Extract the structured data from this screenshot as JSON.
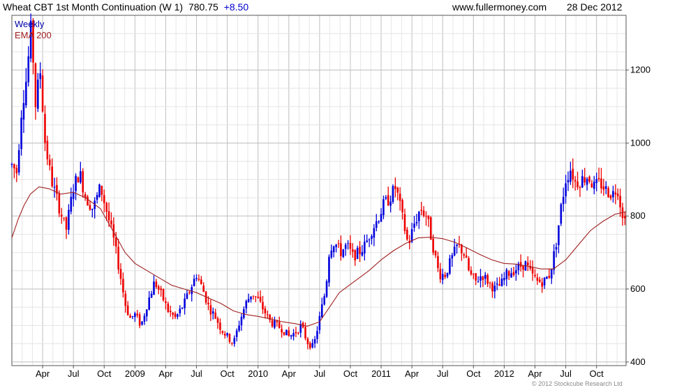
{
  "header": {
    "title": "Wheat CBT 1st Month Continuation (W 1)",
    "last_price": "780.75",
    "change": "+8.50",
    "website": "www.fullermoney.com",
    "date": "28 Dec 2012"
  },
  "credit": "© 2012 Stockcube Research Ltd",
  "colors": {
    "up": "#0000dd",
    "down": "#ee0000",
    "ema": "#a02020",
    "grid": "#c8c8c8",
    "legend_weekly": "#0000aa",
    "legend_ema": "#a02020"
  },
  "chart_data": {
    "type": "candlestick",
    "title": "Wheat CBT 1st Month Continuation (W 1)",
    "legend": [
      {
        "label": "Weekly",
        "color": "#0000aa"
      },
      {
        "label": "EMA 200",
        "color": "#a02020"
      }
    ],
    "ylim": [
      390,
      1350
    ],
    "y_ticks": [
      400,
      600,
      800,
      1000,
      1200
    ],
    "x_range": [
      2008.0,
      2012.99
    ],
    "x_ticks": [
      {
        "label": "Apr",
        "x": 2008.25
      },
      {
        "label": "Jul",
        "x": 2008.5
      },
      {
        "label": "Oct",
        "x": 2008.75
      },
      {
        "label": "2009",
        "x": 2009.0
      },
      {
        "label": "Apr",
        "x": 2009.25
      },
      {
        "label": "Jul",
        "x": 2009.5
      },
      {
        "label": "Oct",
        "x": 2009.75
      },
      {
        "label": "2010",
        "x": 2010.0
      },
      {
        "label": "Apr",
        "x": 2010.25
      },
      {
        "label": "Jul",
        "x": 2010.5
      },
      {
        "label": "Oct",
        "x": 2010.75
      },
      {
        "label": "2011",
        "x": 2011.0
      },
      {
        "label": "Apr",
        "x": 2011.25
      },
      {
        "label": "Jul",
        "x": 2011.5
      },
      {
        "label": "Oct",
        "x": 2011.75
      },
      {
        "label": "2012",
        "x": 2012.0
      },
      {
        "label": "Apr",
        "x": 2012.25
      },
      {
        "label": "Jul",
        "x": 2012.5
      },
      {
        "label": "Oct",
        "x": 2012.75
      }
    ],
    "price_path": [
      [
        2008.0,
        940
      ],
      [
        2008.04,
        920
      ],
      [
        2008.08,
        1100
      ],
      [
        2008.12,
        1180
      ],
      [
        2008.16,
        1330
      ],
      [
        2008.19,
        1100
      ],
      [
        2008.23,
        1200
      ],
      [
        2008.27,
        1000
      ],
      [
        2008.32,
        900
      ],
      [
        2008.38,
        830
      ],
      [
        2008.44,
        760
      ],
      [
        2008.5,
        880
      ],
      [
        2008.55,
        920
      ],
      [
        2008.6,
        850
      ],
      [
        2008.66,
        820
      ],
      [
        2008.72,
        880
      ],
      [
        2008.78,
        800
      ],
      [
        2008.83,
        730
      ],
      [
        2008.88,
        640
      ],
      [
        2008.92,
        560
      ],
      [
        2008.96,
        520
      ],
      [
        2009.0,
        530
      ],
      [
        2009.05,
        500
      ],
      [
        2009.1,
        560
      ],
      [
        2009.16,
        620
      ],
      [
        2009.22,
        580
      ],
      [
        2009.27,
        540
      ],
      [
        2009.33,
        520
      ],
      [
        2009.4,
        560
      ],
      [
        2009.45,
        600
      ],
      [
        2009.5,
        640
      ],
      [
        2009.55,
        600
      ],
      [
        2009.6,
        550
      ],
      [
        2009.66,
        520
      ],
      [
        2009.7,
        490
      ],
      [
        2009.75,
        470
      ],
      [
        2009.8,
        450
      ],
      [
        2009.85,
        510
      ],
      [
        2009.9,
        560
      ],
      [
        2009.95,
        590
      ],
      [
        2010.0,
        570
      ],
      [
        2010.05,
        540
      ],
      [
        2010.1,
        510
      ],
      [
        2010.15,
        500
      ],
      [
        2010.2,
        490
      ],
      [
        2010.25,
        470
      ],
      [
        2010.3,
        480
      ],
      [
        2010.35,
        500
      ],
      [
        2010.4,
        455
      ],
      [
        2010.45,
        440
      ],
      [
        2010.5,
        520
      ],
      [
        2010.55,
        600
      ],
      [
        2010.58,
        710
      ],
      [
        2010.62,
        730
      ],
      [
        2010.67,
        700
      ],
      [
        2010.72,
        720
      ],
      [
        2010.77,
        690
      ],
      [
        2010.82,
        700
      ],
      [
        2010.87,
        720
      ],
      [
        2010.92,
        760
      ],
      [
        2010.97,
        790
      ],
      [
        2011.02,
        830
      ],
      [
        2011.07,
        850
      ],
      [
        2011.12,
        880
      ],
      [
        2011.17,
        800
      ],
      [
        2011.22,
        720
      ],
      [
        2011.27,
        780
      ],
      [
        2011.32,
        820
      ],
      [
        2011.37,
        800
      ],
      [
        2011.42,
        720
      ],
      [
        2011.47,
        640
      ],
      [
        2011.52,
        640
      ],
      [
        2011.57,
        680
      ],
      [
        2011.62,
        720
      ],
      [
        2011.67,
        700
      ],
      [
        2011.72,
        640
      ],
      [
        2011.77,
        620
      ],
      [
        2011.82,
        640
      ],
      [
        2011.87,
        620
      ],
      [
        2011.92,
        600
      ],
      [
        2011.97,
        610
      ],
      [
        2012.02,
        640
      ],
      [
        2012.07,
        650
      ],
      [
        2012.12,
        660
      ],
      [
        2012.17,
        670
      ],
      [
        2012.22,
        640
      ],
      [
        2012.27,
        620
      ],
      [
        2012.32,
        620
      ],
      [
        2012.37,
        640
      ],
      [
        2012.42,
        720
      ],
      [
        2012.46,
        820
      ],
      [
        2012.5,
        900
      ],
      [
        2012.54,
        930
      ],
      [
        2012.58,
        890
      ],
      [
        2012.63,
        900
      ],
      [
        2012.68,
        910
      ],
      [
        2012.73,
        880
      ],
      [
        2012.78,
        890
      ],
      [
        2012.83,
        870
      ],
      [
        2012.88,
        860
      ],
      [
        2012.92,
        880
      ],
      [
        2012.95,
        820
      ],
      [
        2012.99,
        781
      ]
    ],
    "ema_path": [
      [
        2008.0,
        740
      ],
      [
        2008.05,
        790
      ],
      [
        2008.1,
        830
      ],
      [
        2008.15,
        860
      ],
      [
        2008.22,
        880
      ],
      [
        2008.3,
        875
      ],
      [
        2008.4,
        860
      ],
      [
        2008.5,
        865
      ],
      [
        2008.6,
        850
      ],
      [
        2008.72,
        820
      ],
      [
        2008.82,
        760
      ],
      [
        2008.92,
        700
      ],
      [
        2009.0,
        670
      ],
      [
        2009.1,
        650
      ],
      [
        2009.2,
        630
      ],
      [
        2009.3,
        610
      ],
      [
        2009.4,
        600
      ],
      [
        2009.5,
        590
      ],
      [
        2009.6,
        575
      ],
      [
        2009.7,
        560
      ],
      [
        2009.8,
        540
      ],
      [
        2009.9,
        530
      ],
      [
        2010.0,
        525
      ],
      [
        2010.1,
        518
      ],
      [
        2010.2,
        510
      ],
      [
        2010.3,
        505
      ],
      [
        2010.4,
        498
      ],
      [
        2010.5,
        510
      ],
      [
        2010.58,
        550
      ],
      [
        2010.66,
        590
      ],
      [
        2010.74,
        610
      ],
      [
        2010.82,
        630
      ],
      [
        2010.9,
        650
      ],
      [
        2011.0,
        680
      ],
      [
        2011.1,
        705
      ],
      [
        2011.2,
        725
      ],
      [
        2011.3,
        740
      ],
      [
        2011.4,
        742
      ],
      [
        2011.5,
        738
      ],
      [
        2011.6,
        728
      ],
      [
        2011.7,
        712
      ],
      [
        2011.8,
        695
      ],
      [
        2011.9,
        680
      ],
      [
        2012.0,
        670
      ],
      [
        2012.1,
        668
      ],
      [
        2012.2,
        662
      ],
      [
        2012.3,
        655
      ],
      [
        2012.4,
        655
      ],
      [
        2012.5,
        680
      ],
      [
        2012.6,
        720
      ],
      [
        2012.7,
        760
      ],
      [
        2012.8,
        785
      ],
      [
        2012.9,
        805
      ],
      [
        2012.99,
        812
      ]
    ]
  }
}
